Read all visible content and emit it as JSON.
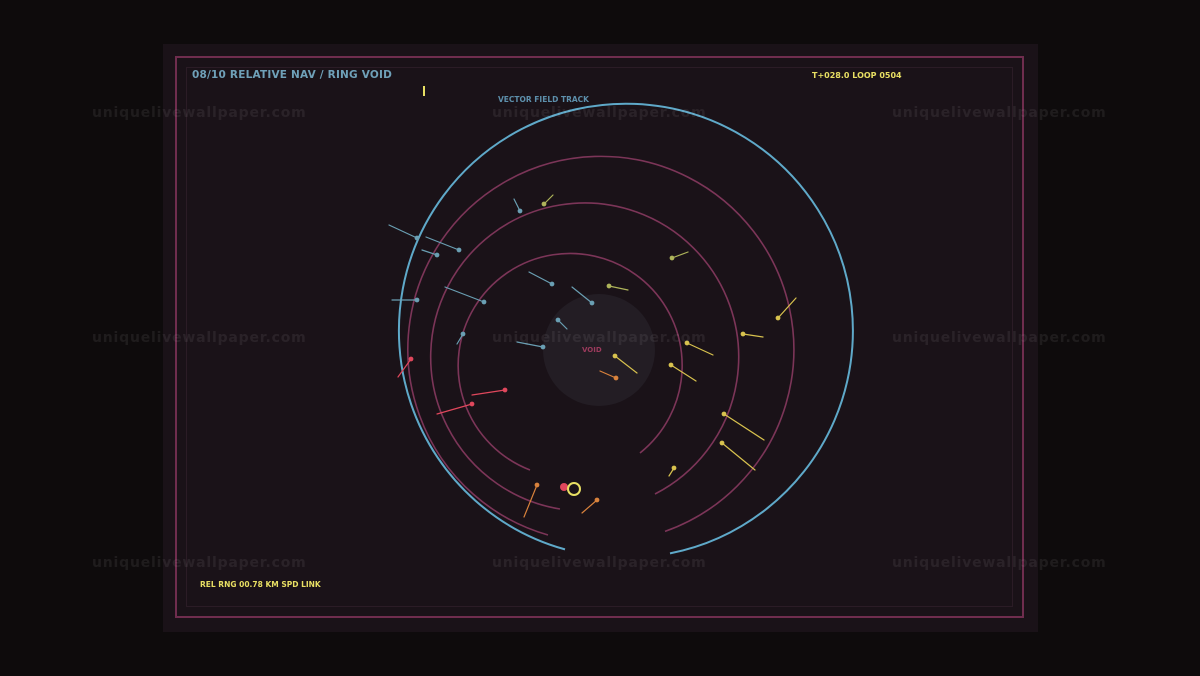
{
  "hud": {
    "level_title": "08/10  RELATIVE NAV / RING VOID",
    "timer": "T+028.0  LOOP 0504",
    "subtitle": "VECTOR FIELD  TRACK",
    "range_readout": "REL RNG 00.78 KM  SPD LINK",
    "void_label": "VOID"
  },
  "watermark": "uniquelivewallpaper.com",
  "colors": {
    "background": "#0e0b0c",
    "panel": "#1a1218",
    "frame": "#6f2d4e",
    "outer_ring": "#5fa9c9",
    "inner_rings": "#7c3558",
    "void": "#231d24",
    "accent_yellow": "#e8df63",
    "accent_blue": "#6fa0b8",
    "accent_red": "#e0475c"
  },
  "player": {
    "icon": "ring-cursor-icon",
    "color": "#e8df63"
  },
  "target": {
    "icon": "red-dot-icon",
    "color": "#e0475c"
  }
}
